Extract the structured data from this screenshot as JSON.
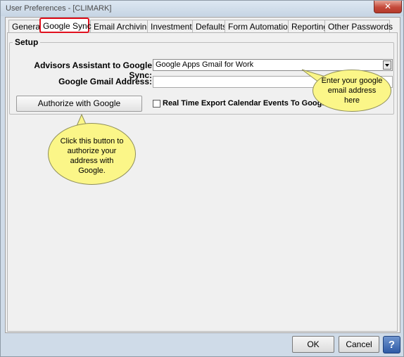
{
  "window": {
    "title": "User Preferences -  [CLIMARK]",
    "close_label": "✕"
  },
  "tabs": [
    {
      "label": "General",
      "active": false
    },
    {
      "label": "Google Sync",
      "active": true
    },
    {
      "label": "Email Archiving",
      "active": false
    },
    {
      "label": "Investments",
      "active": false
    },
    {
      "label": "Defaults",
      "active": false
    },
    {
      "label": "Form Automation",
      "active": false
    },
    {
      "label": "Reporting",
      "active": false
    },
    {
      "label": "Other Passwords",
      "active": false
    }
  ],
  "setup": {
    "legend": "Setup",
    "sync_label": "Advisors Assistant to Google Sync:",
    "sync_value": "Google Apps Gmail for Work",
    "gmail_label": "Google Gmail Address:",
    "gmail_value": "",
    "authorize_label": "Authorize with Google",
    "realtime_label": "Real Time Export Calendar Events To Google",
    "realtime_checked": false
  },
  "callouts": {
    "email": "Enter your google email address here",
    "authorize": "Click this button to authorize your address with Google."
  },
  "footer": {
    "ok_label": "OK",
    "cancel_label": "Cancel",
    "help_label": "?"
  },
  "colors": {
    "callout_fill": "#fbf688",
    "active_tab_outline": "#e0101e",
    "help_button": "#2e5aa6"
  }
}
